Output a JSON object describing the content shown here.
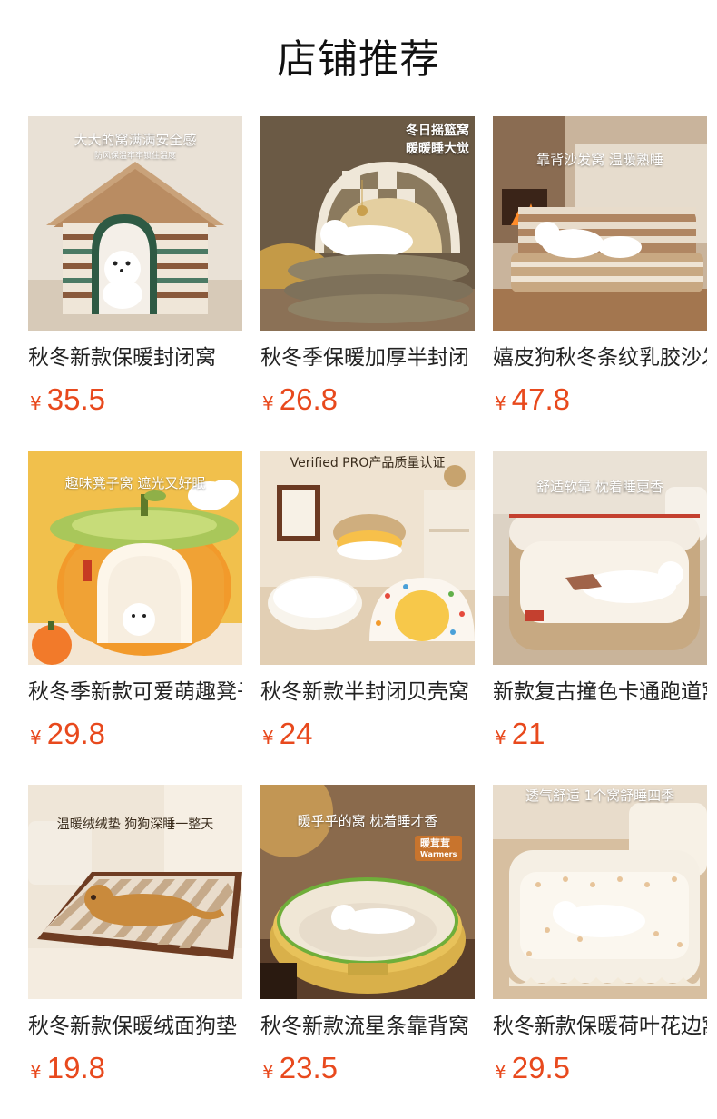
{
  "page": {
    "title": "店铺推荐"
  },
  "currency_symbol": "¥",
  "colors": {
    "price": "#e8491d",
    "title": "#111111",
    "product_name": "#222222"
  },
  "products": [
    {
      "name": "秋冬新款保暖封闭窝",
      "price": "35.5",
      "image_caption": "大大的窝满满安全感",
      "image_subcaption": "防风保温牢牢锁住温度"
    },
    {
      "name": "秋冬季保暖加厚半封闭",
      "price": "26.8",
      "image_caption_line1": "冬日摇篮窝",
      "image_caption_line2": "暖暖睡大觉"
    },
    {
      "name": "嬉皮狗秋冬条纹乳胶沙发",
      "price": "47.8",
      "image_caption": "靠背沙发窝 温暖熟睡"
    },
    {
      "name": "秋冬季新款可爱萌趣凳子窝",
      "price": "29.8",
      "image_caption": "趣味凳子窝 遮光又好眠"
    },
    {
      "name": "秋冬新款半封闭贝壳窝",
      "price": "24",
      "image_caption": "Verified PRO产品质量认证"
    },
    {
      "name": "新款复古撞色卡通跑道窝",
      "price": "21",
      "image_caption": "舒适软靠 枕着睡更香"
    },
    {
      "name": "秋冬新款保暖绒面狗垫",
      "price": "19.8",
      "image_caption": "温暖绒绒垫 狗狗深睡一整天"
    },
    {
      "name": "秋冬新款流星条靠背窝",
      "price": "23.5",
      "image_caption": "暖乎乎的窝 枕着睡才香",
      "image_badge": "暖茸茸",
      "image_badge_sub": "Warmers"
    },
    {
      "name": "秋冬新款保暖荷叶花边窝",
      "price": "29.5",
      "image_caption": "透气舒适 1个窝舒睡四季"
    }
  ]
}
